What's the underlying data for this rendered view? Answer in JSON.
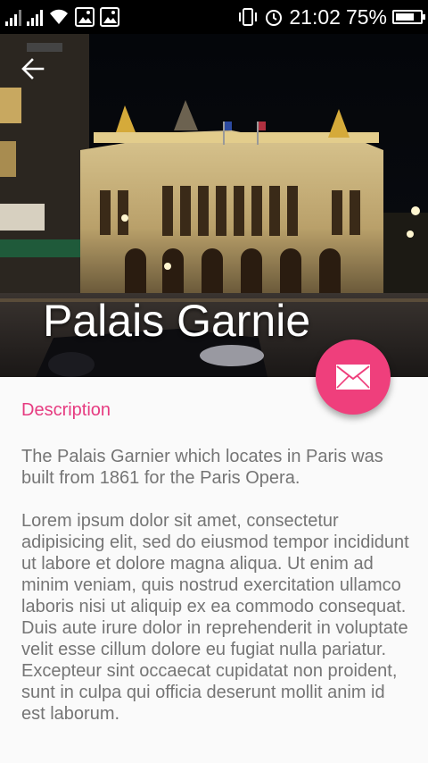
{
  "status_bar": {
    "time": "21:02",
    "battery_percent": "75%",
    "battery_level": 0.75,
    "icons": [
      "signal-icon",
      "signal-icon",
      "wifi-icon",
      "gallery-icon",
      "gallery-icon",
      "vibrate-icon",
      "alarm-icon",
      "battery-icon"
    ]
  },
  "header": {
    "title": "Palais Garnie",
    "back_icon": "arrow-left-icon"
  },
  "fab": {
    "icon": "mail-icon",
    "color": "#ef3f7c"
  },
  "content": {
    "section_label": "Description",
    "paragraphs": [
      "The Palais Garnier which locates in Paris was built from 1861 for the Paris Opera.",
      "Lorem ipsum dolor sit amet, consectetur adipisicing elit, sed do eiusmod tempor incididunt ut labore et dolore magna aliqua. Ut enim ad minim veniam, quis nostrud exercitation ullamco laboris nisi ut aliquip ex ea commodo consequat. Duis aute irure dolor in reprehenderit in voluptate velit esse cillum dolore eu fugiat nulla pariatur. Excepteur sint occaecat cupidatat non proident, sunt in culpa qui officia deserunt mollit anim id est laborum."
    ]
  },
  "colors": {
    "accent": "#e63b80",
    "body_text": "#757575",
    "background": "#fafafa"
  }
}
